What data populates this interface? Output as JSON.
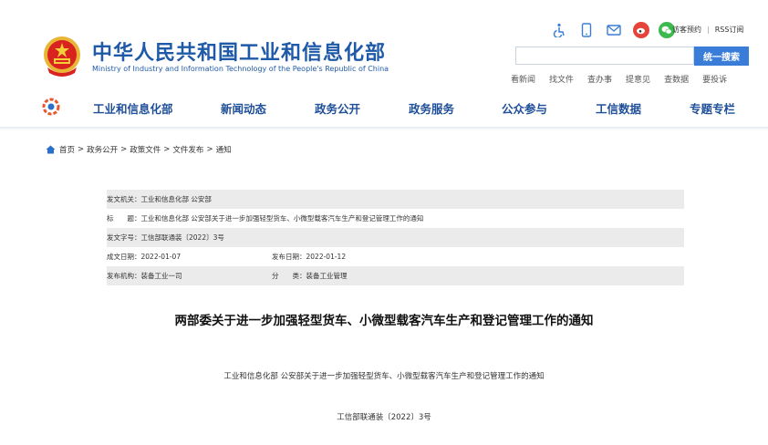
{
  "header": {
    "title": "中华人民共和国工业和信息化部",
    "subtitle": "Ministry of Industry and Information Technology of the People's Republic of China",
    "visit": "访客预约",
    "rss": "RSS订阅",
    "separator": "|",
    "search_placeholder": "",
    "search_button": "统一搜索",
    "quick_links": [
      "看新闻",
      "找文件",
      "查办事",
      "提意见",
      "查数据",
      "要投诉"
    ],
    "icons": [
      "accessibility-icon",
      "mobile-icon",
      "mail-icon",
      "weibo-icon",
      "wechat-icon"
    ]
  },
  "nav": {
    "items": [
      "工业和信息化部",
      "新闻动态",
      "政务公开",
      "政务服务",
      "公众参与",
      "工信数据",
      "专题专栏"
    ]
  },
  "breadcrumb": {
    "items": [
      "首页",
      "政务公开",
      "政策文件",
      "文件发布",
      "通知"
    ],
    "separator": ">"
  },
  "meta": {
    "issuer_label": "发文机关：",
    "issuer": "工业和信息化部 公安部",
    "title_label": "标　　题：",
    "title": "工业和信息化部 公安部关于进一步加强轻型货车、小微型载客汽车生产和登记管理工作的通知",
    "docno_label": "发文字号：",
    "docno": "工信部联通装〔2022〕3号",
    "created_label": "成文日期：",
    "created": "2022-01-07",
    "published_label": "发布日期：",
    "published": "2022-01-12",
    "org_label": "发布机构：",
    "org": "装备工业一司",
    "category_label": "分　　类：",
    "category": "装备工业管理"
  },
  "document": {
    "title": "两部委关于进一步加强轻型货车、小微型载客汽车生产和登记管理工作的通知",
    "line1": "工业和信息化部 公安部关于进一步加强轻型货车、小微型载客汽车生产和登记管理工作的通知",
    "line2": "工信部联通装〔2022〕3号"
  },
  "colors": {
    "brand_blue": "#1f5aa8",
    "search_blue": "#3a7dd8",
    "emblem_red": "#d8231f",
    "emblem_gold": "#e8b634"
  }
}
